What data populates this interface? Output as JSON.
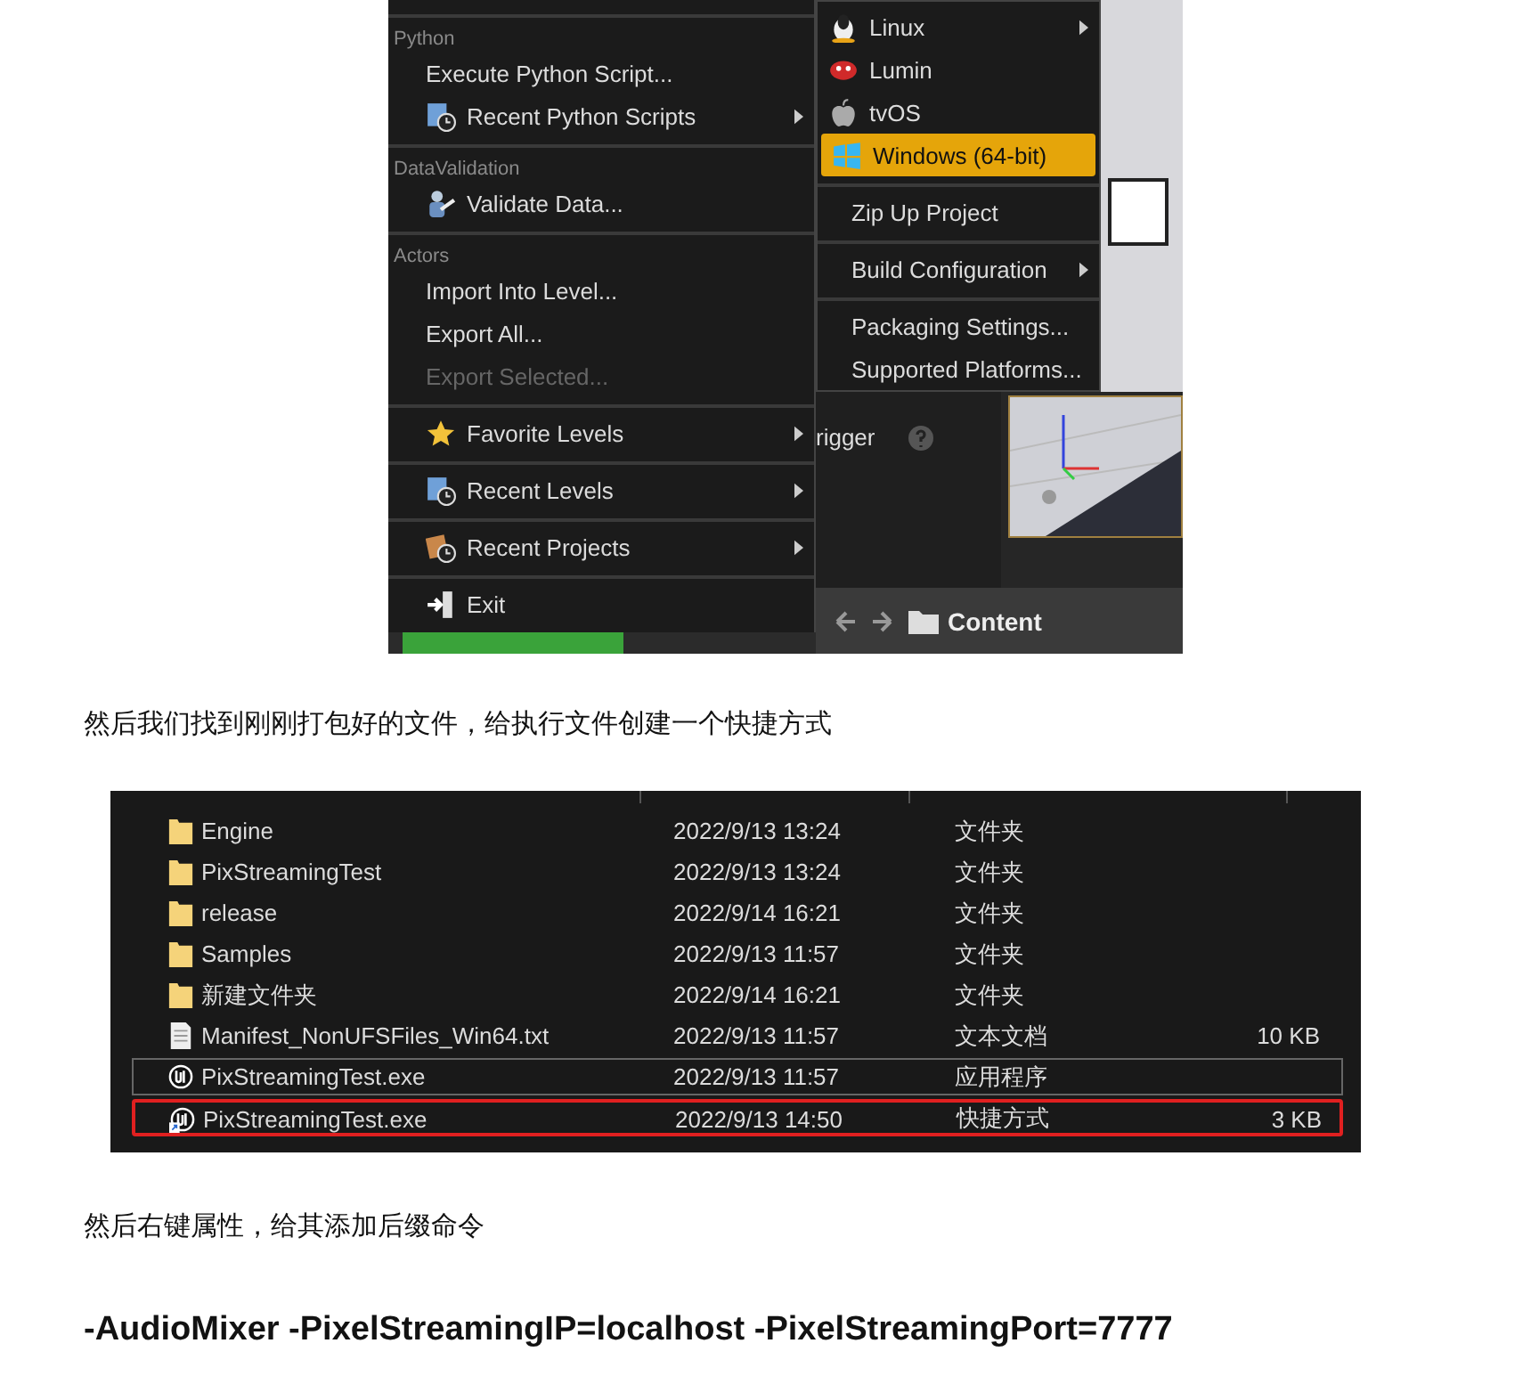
{
  "editor_screenshot": {
    "file_menu": {
      "groups": [
        {
          "header": "Python",
          "items": [
            {
              "label": "Execute Python Script...",
              "kind": "plain",
              "has_submenu": false,
              "disabled": false
            },
            {
              "label": "Recent Python Scripts",
              "kind": "recent",
              "has_submenu": true,
              "disabled": false
            }
          ]
        },
        {
          "header": "DataValidation",
          "items": [
            {
              "label": "Validate Data...",
              "kind": "validate",
              "has_submenu": false,
              "disabled": false
            }
          ]
        },
        {
          "header": "Actors",
          "items": [
            {
              "label": "Import Into Level...",
              "kind": "plain",
              "has_submenu": false,
              "disabled": false
            },
            {
              "label": "Export All...",
              "kind": "plain",
              "has_submenu": false,
              "disabled": false
            },
            {
              "label": "Export Selected...",
              "kind": "plain",
              "has_submenu": false,
              "disabled": true
            }
          ]
        },
        {
          "items": [
            {
              "label": "Favorite Levels",
              "kind": "favorite",
              "has_submenu": true,
              "disabled": false
            }
          ]
        },
        {
          "items": [
            {
              "label": "Recent Levels",
              "kind": "recent",
              "has_submenu": true,
              "disabled": false
            }
          ]
        },
        {
          "items": [
            {
              "label": "Recent Projects",
              "kind": "projects",
              "has_submenu": true,
              "disabled": false
            }
          ]
        },
        {
          "items": [
            {
              "label": "Exit",
              "kind": "exit",
              "has_submenu": false,
              "disabled": false
            }
          ]
        }
      ]
    },
    "platform_submenu": {
      "groups": [
        {
          "items": [
            {
              "label": "Linux",
              "kind": "linux",
              "has_submenu": true,
              "selected": false
            },
            {
              "label": "Lumin",
              "kind": "lumin",
              "has_submenu": false,
              "selected": false
            },
            {
              "label": "tvOS",
              "kind": "tvos",
              "has_submenu": false,
              "selected": false
            },
            {
              "label": "Windows (64-bit)",
              "kind": "windows",
              "has_submenu": false,
              "selected": true
            }
          ]
        },
        {
          "items": [
            {
              "label": "Zip Up Project",
              "kind": "plain",
              "has_submenu": false,
              "selected": false
            }
          ]
        },
        {
          "items": [
            {
              "label": "Build Configuration",
              "kind": "plain",
              "has_submenu": true,
              "selected": false
            }
          ]
        },
        {
          "items": [
            {
              "label": "Packaging Settings...",
              "kind": "plain",
              "has_submenu": false,
              "selected": false
            },
            {
              "label": "Supported Platforms...",
              "kind": "plain",
              "has_submenu": false,
              "selected": false
            }
          ]
        }
      ]
    },
    "details_panel": {
      "label": "rigger"
    },
    "content_browser": {
      "label": "Content"
    }
  },
  "paragraphs": [
    "然后我们找到刚刚打包好的文件，给执行文件创建一个快捷方式"
  ],
  "file_list": {
    "rows": [
      {
        "kind": "folder",
        "name": "Engine",
        "date": "2022/9/13 13:24",
        "type": "文件夹",
        "hovered": false,
        "highlighted": false
      },
      {
        "kind": "folder",
        "name": "PixStreamingTest",
        "date": "2022/9/13 13:24",
        "type": "文件夹",
        "hovered": false,
        "highlighted": false
      },
      {
        "kind": "folder",
        "name": "release",
        "date": "2022/9/14 16:21",
        "type": "文件夹",
        "hovered": false,
        "highlighted": false
      },
      {
        "kind": "folder",
        "name": "Samples",
        "date": "2022/9/13 11:57",
        "type": "文件夹",
        "hovered": false,
        "highlighted": false
      },
      {
        "kind": "folder",
        "name": "新建文件夹",
        "date": "2022/9/14 16:21",
        "type": "文件夹",
        "hovered": false,
        "highlighted": false
      },
      {
        "kind": "document",
        "name": "Manifest_NonUFSFiles_Win64.txt",
        "date": "2022/9/13 11:57",
        "type": "文本文档",
        "size": "10 KB",
        "hovered": false,
        "highlighted": false
      },
      {
        "kind": "application",
        "name": "PixStreamingTest.exe",
        "date": "2022/9/13 11:57",
        "type": "应用程序",
        "hovered": true,
        "highlighted": false
      },
      {
        "kind": "shortcut",
        "name": "PixStreamingTest.exe",
        "date": "2022/9/13 14:50",
        "type": "快捷方式",
        "size": "3 KB",
        "hovered": false,
        "highlighted": true
      }
    ]
  },
  "paragraphs_after": [
    "然后右键属性，给其添加后缀命令"
  ],
  "command": "-AudioMixer -PixelStreamingIP=localhost -PixelStreamingPort=7777"
}
